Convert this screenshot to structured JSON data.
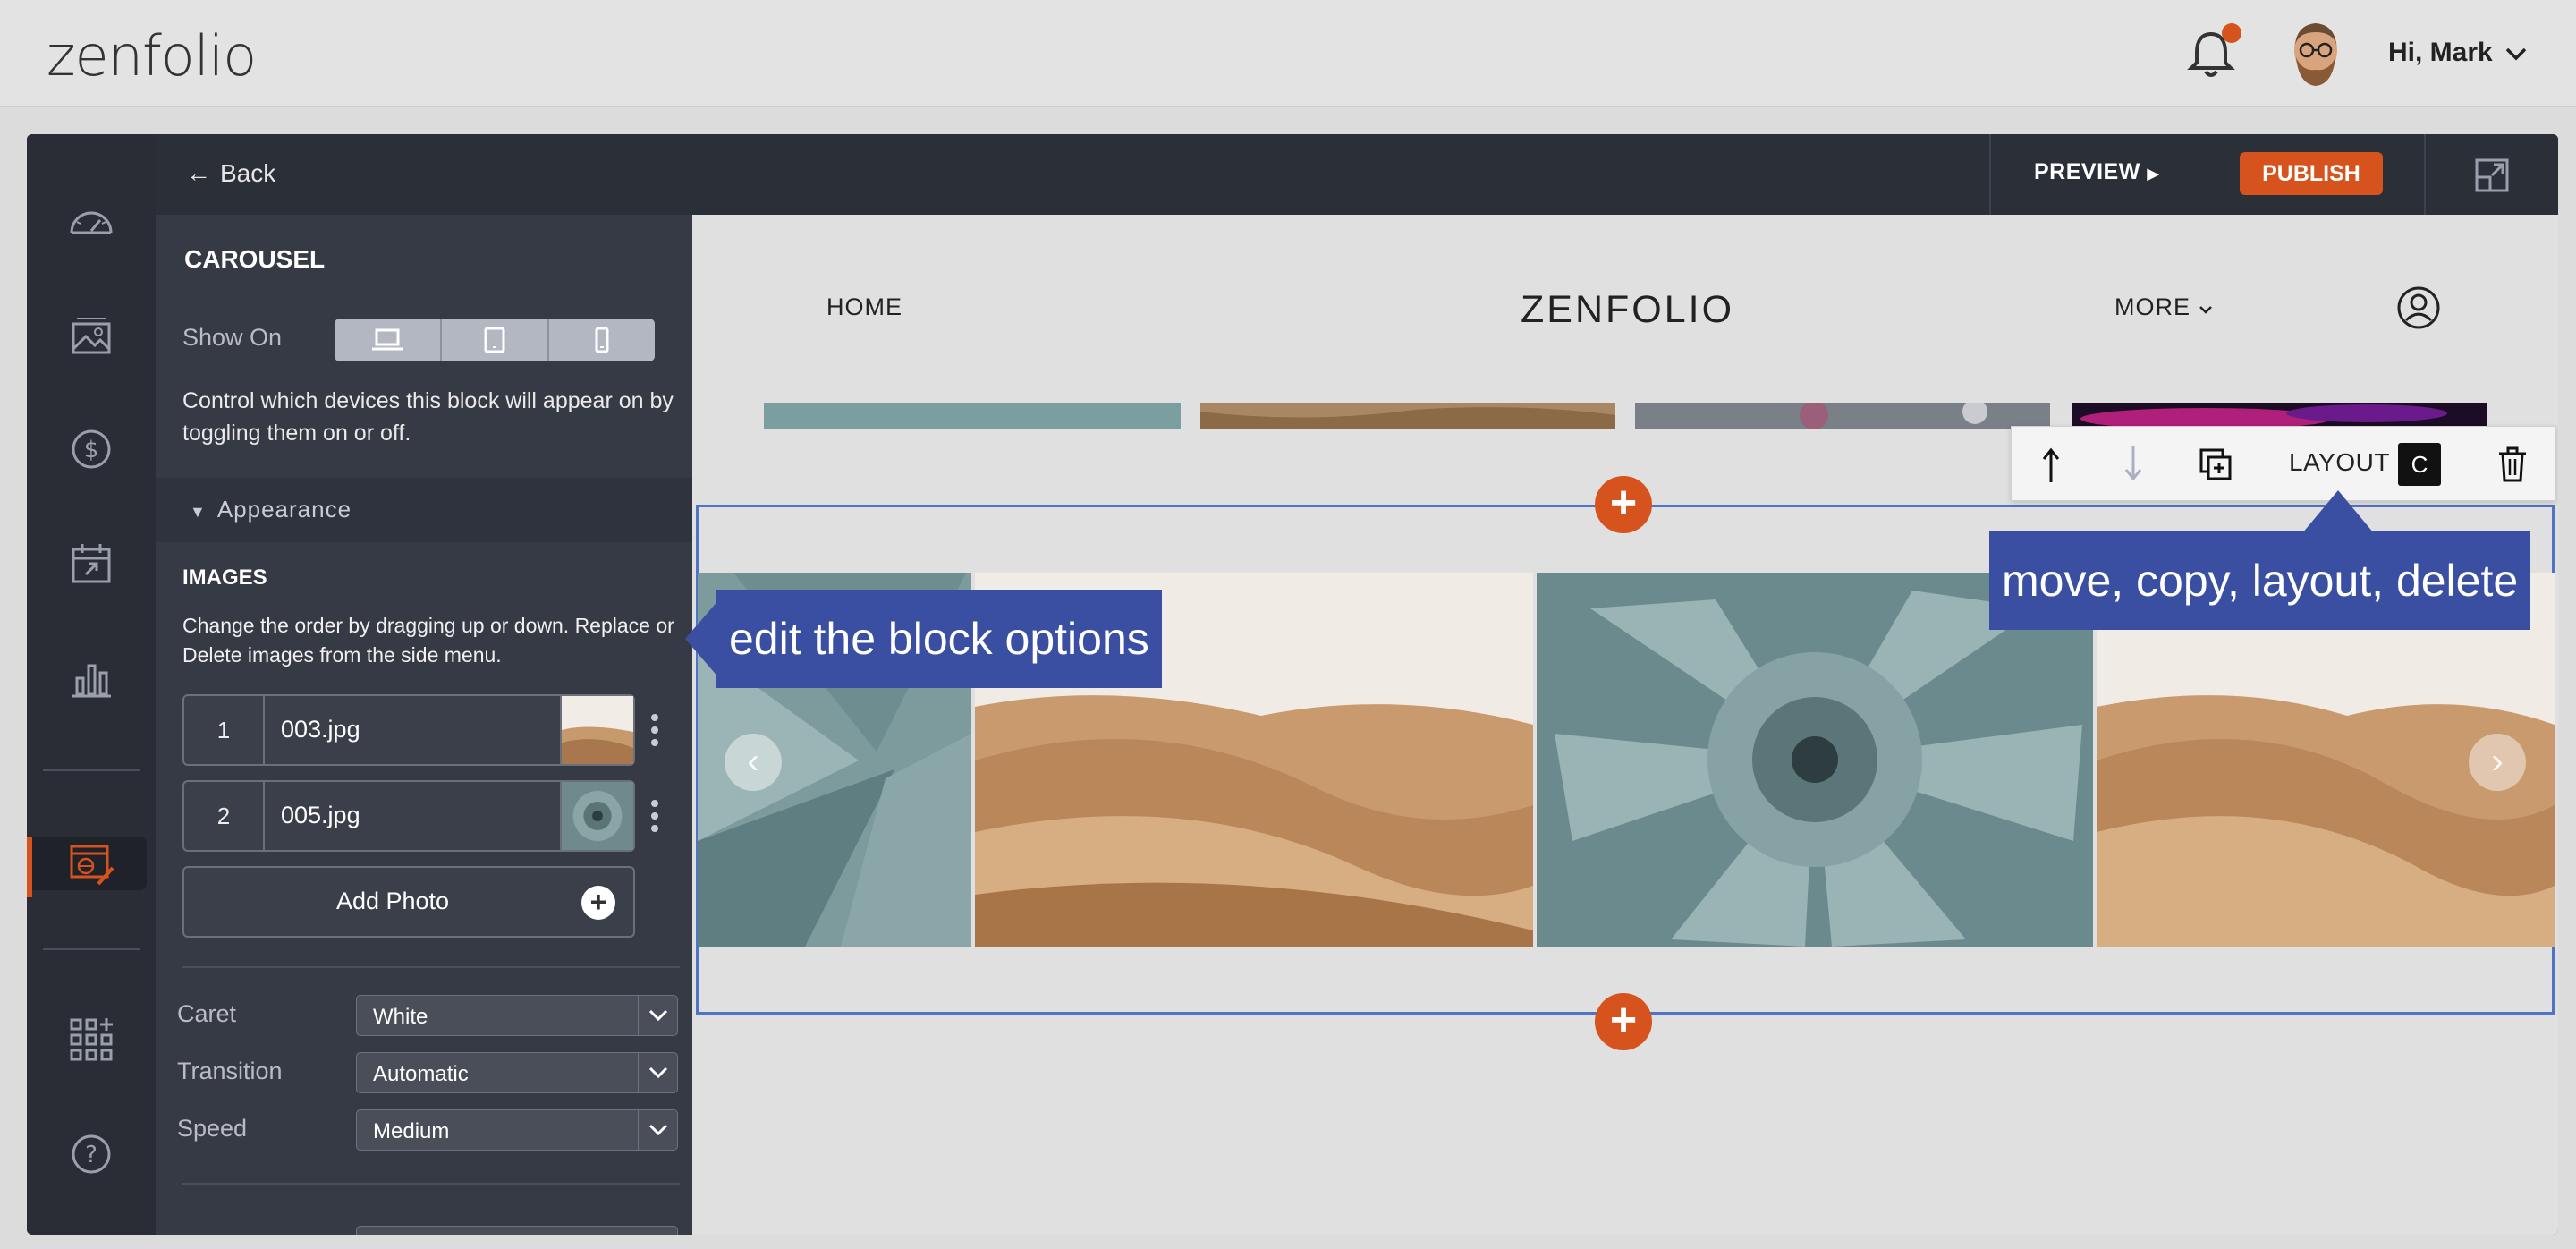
{
  "app": {
    "logo": "zenfolio",
    "greeting": "Hi, Mark"
  },
  "panel": {
    "back_label": "Back",
    "block_title": "CAROUSEL",
    "show_on_label": "Show On",
    "show_on_description": "Control which devices this block will appear on by toggling them on or off.",
    "appearance_label": "Appearance",
    "images_heading": "IMAGES",
    "images_description": "Change the order by dragging up or down. Replace or Delete images from the side menu.",
    "images": [
      {
        "num": "1",
        "name": "003.jpg"
      },
      {
        "num": "2",
        "name": "005.jpg"
      }
    ],
    "add_photo_label": "Add Photo",
    "options": [
      {
        "label": "Caret",
        "value": "White"
      },
      {
        "label": "Transition",
        "value": "Automatic"
      },
      {
        "label": "Speed",
        "value": "Medium"
      }
    ]
  },
  "header_actions": {
    "preview_label": "PREVIEW",
    "publish_label": "PUBLISH"
  },
  "site": {
    "nav_home": "HOME",
    "brand": "ZENFOLIO",
    "nav_more": "MORE"
  },
  "block_toolbar": {
    "layout_label": "LAYOUT",
    "layout_value": "C"
  },
  "callouts": {
    "left": "edit the block options",
    "right": "move, copy, layout, delete"
  },
  "colors": {
    "accent": "#d6531d",
    "callout": "#3a4fa1",
    "selection": "#4f74c4"
  }
}
